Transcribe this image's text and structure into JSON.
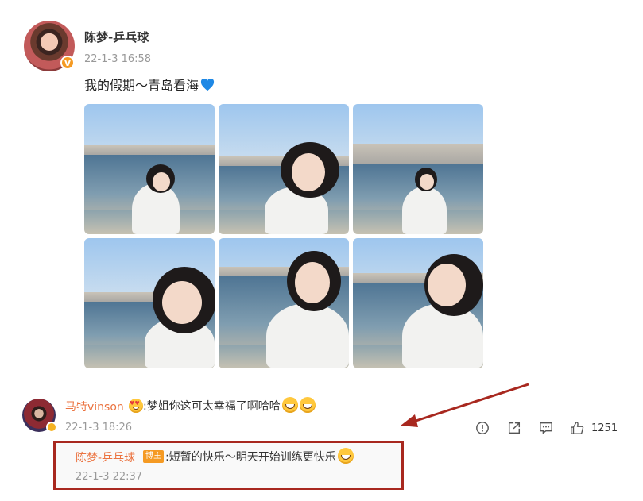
{
  "post": {
    "author": "陈梦-乒乓球",
    "time": "22-1-3 16:58",
    "text": "我的假期～青岛看海",
    "text_emoji": "blue-heart-icon"
  },
  "photos": [
    {
      "alt": "photo-1"
    },
    {
      "alt": "photo-2"
    },
    {
      "alt": "photo-3"
    },
    {
      "alt": "photo-4"
    },
    {
      "alt": "photo-5"
    },
    {
      "alt": "photo-6"
    }
  ],
  "comment": {
    "author": "马特vinson",
    "text": ":梦姐你这可太幸福了啊哈哈",
    "time": "22-1-3 18:26",
    "likes": "1251"
  },
  "reply": {
    "author": "陈梦-乒乓球",
    "badge": "博主",
    "text": ":短暂的快乐～明天开始训练更快乐",
    "time": "22-1-3 22:37"
  },
  "colors": {
    "accent_name": "#eb7340",
    "highlight_box": "#a8281f",
    "verified": "#f59a23",
    "heart": "#1e88e5"
  }
}
